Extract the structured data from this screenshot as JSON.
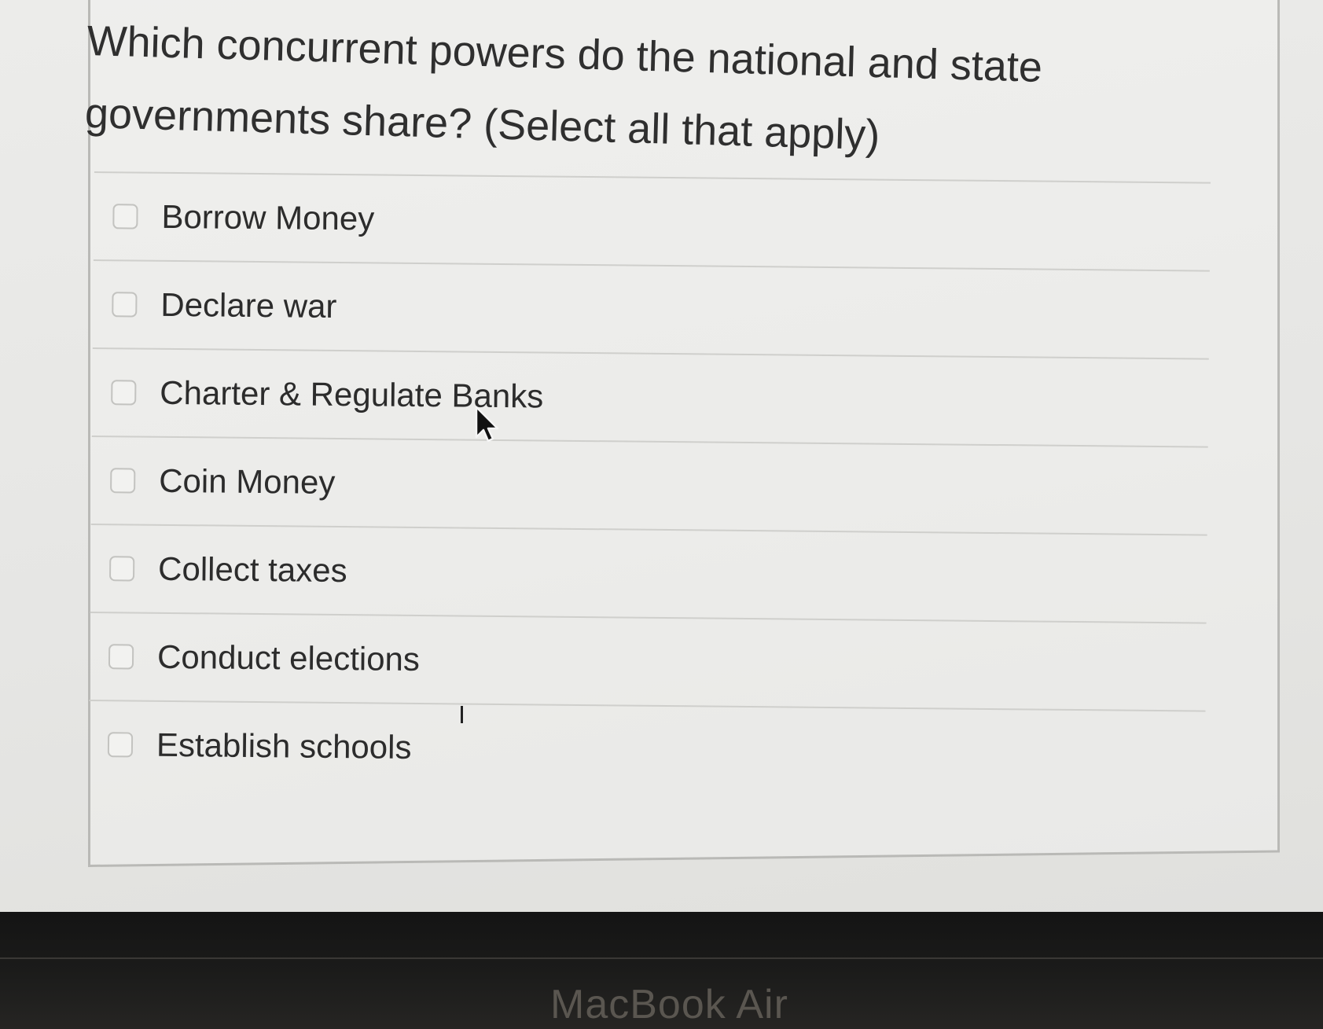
{
  "question": {
    "text": "Which concurrent powers do the national and state governments share? (Select all that apply)"
  },
  "options": [
    {
      "label": "Borrow Money",
      "checked": false
    },
    {
      "label": "Declare war",
      "checked": false
    },
    {
      "label": "Charter & Regulate Banks",
      "checked": false
    },
    {
      "label": "Coin Money",
      "checked": false
    },
    {
      "label": "Collect taxes",
      "checked": false
    },
    {
      "label": "Conduct elections",
      "checked": false
    },
    {
      "label": "Establish schools",
      "checked": false
    }
  ],
  "device": {
    "brand_label": "MacBook Air"
  },
  "colors": {
    "background": "#e9e9e7",
    "text": "#2f2f2f",
    "bezel": "#141414"
  }
}
